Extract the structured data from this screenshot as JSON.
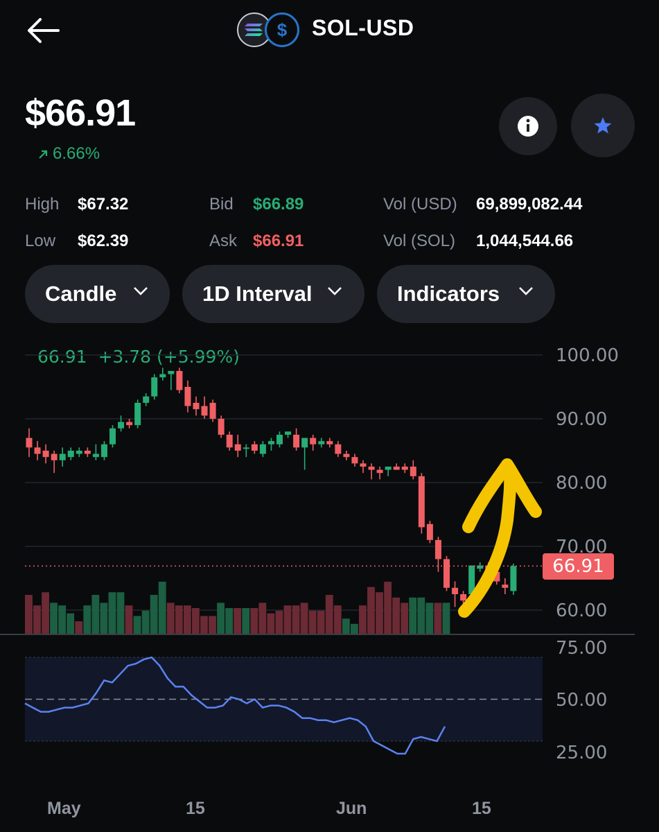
{
  "header": {
    "title": "SOL-USD",
    "base_icon": "solana-logo",
    "quote_icon": "usd-coin-logo"
  },
  "price": {
    "current": "$66.91",
    "change": "6.66%"
  },
  "stats": {
    "high_label": "High",
    "high_value": "$67.32",
    "low_label": "Low",
    "low_value": "$62.39",
    "bid_label": "Bid",
    "bid_value": "$66.89",
    "ask_label": "Ask",
    "ask_value": "$66.91",
    "vol_usd_label": "Vol (USD)",
    "vol_usd_value": "69,899,082.44",
    "vol_sol_label": "Vol (SOL)",
    "vol_sol_value": "1,044,544.66"
  },
  "controls": {
    "chart_type": "Candle",
    "interval": "1D Interval",
    "indicators": "Indicators"
  },
  "colors": {
    "up": "#27ad75",
    "down": "#f05f63",
    "accent": "#4c7cf5",
    "rsi_line": "#5b83f0",
    "annotation": "#f5c400"
  },
  "chart_data": {
    "type": "candlestick",
    "summary": "66.91  +3.78 (+5.99%)",
    "last_price_tag": "66.91",
    "y_ticks": [
      "100.00",
      "90.00",
      "80.00",
      "70.00",
      "60.00"
    ],
    "ylim": [
      56,
      100
    ],
    "x_ticks": [
      "May",
      "15",
      "Jun",
      "15"
    ],
    "candles": [
      {
        "o": 87.0,
        "h": 88.5,
        "l": 84.0,
        "c": 85.5
      },
      {
        "o": 85.5,
        "h": 86.5,
        "l": 83.5,
        "c": 84.5
      },
      {
        "o": 85.0,
        "h": 86.0,
        "l": 83.0,
        "c": 84.0
      },
      {
        "o": 84.5,
        "h": 85.0,
        "l": 81.5,
        "c": 83.5
      },
      {
        "o": 83.5,
        "h": 85.5,
        "l": 82.5,
        "c": 84.5
      },
      {
        "o": 84.0,
        "h": 85.5,
        "l": 83.5,
        "c": 85.0
      },
      {
        "o": 84.5,
        "h": 85.5,
        "l": 84.0,
        "c": 85.0
      },
      {
        "o": 85.0,
        "h": 85.5,
        "l": 84.0,
        "c": 84.5
      },
      {
        "o": 84.0,
        "h": 86.0,
        "l": 83.5,
        "c": 84.5
      },
      {
        "o": 84.0,
        "h": 86.5,
        "l": 83.5,
        "c": 86.0
      },
      {
        "o": 86.0,
        "h": 89.0,
        "l": 85.5,
        "c": 88.5
      },
      {
        "o": 88.5,
        "h": 90.5,
        "l": 88.0,
        "c": 89.5
      },
      {
        "o": 89.5,
        "h": 90.0,
        "l": 88.5,
        "c": 89.0
      },
      {
        "o": 89.0,
        "h": 93.0,
        "l": 88.5,
        "c": 92.5
      },
      {
        "o": 92.5,
        "h": 94.0,
        "l": 92.0,
        "c": 93.5
      },
      {
        "o": 93.5,
        "h": 97.0,
        "l": 93.0,
        "c": 96.5
      },
      {
        "o": 96.5,
        "h": 98.0,
        "l": 96.0,
        "c": 97.0
      },
      {
        "o": 97.0,
        "h": 97.5,
        "l": 94.5,
        "c": 97.5
      },
      {
        "o": 97.5,
        "h": 98.0,
        "l": 94.0,
        "c": 94.5
      },
      {
        "o": 95.0,
        "h": 96.0,
        "l": 91.0,
        "c": 92.0
      },
      {
        "o": 92.5,
        "h": 93.5,
        "l": 90.5,
        "c": 91.5
      },
      {
        "o": 92.0,
        "h": 93.5,
        "l": 90.0,
        "c": 90.5
      },
      {
        "o": 92.5,
        "h": 93.0,
        "l": 89.5,
        "c": 90.0
      },
      {
        "o": 90.0,
        "h": 90.5,
        "l": 87.0,
        "c": 87.5
      },
      {
        "o": 87.5,
        "h": 88.0,
        "l": 85.0,
        "c": 85.5
      },
      {
        "o": 86.0,
        "h": 87.5,
        "l": 84.0,
        "c": 85.0
      },
      {
        "o": 85.5,
        "h": 86.0,
        "l": 84.0,
        "c": 85.5
      },
      {
        "o": 86.0,
        "h": 86.5,
        "l": 84.5,
        "c": 85.0
      },
      {
        "o": 84.5,
        "h": 86.5,
        "l": 84.0,
        "c": 86.0
      },
      {
        "o": 86.0,
        "h": 87.0,
        "l": 85.0,
        "c": 86.5
      },
      {
        "o": 86.0,
        "h": 88.0,
        "l": 85.5,
        "c": 87.5
      },
      {
        "o": 87.5,
        "h": 88.0,
        "l": 87.0,
        "c": 88.0
      },
      {
        "o": 87.5,
        "h": 88.5,
        "l": 85.0,
        "c": 85.5
      },
      {
        "o": 85.5,
        "h": 87.0,
        "l": 82.0,
        "c": 87.0
      },
      {
        "o": 87.0,
        "h": 87.5,
        "l": 85.0,
        "c": 86.0
      },
      {
        "o": 86.0,
        "h": 87.0,
        "l": 85.5,
        "c": 86.5
      },
      {
        "o": 86.5,
        "h": 87.0,
        "l": 85.5,
        "c": 86.0
      },
      {
        "o": 86.0,
        "h": 86.5,
        "l": 84.0,
        "c": 84.5
      },
      {
        "o": 84.5,
        "h": 85.0,
        "l": 83.5,
        "c": 84.0
      },
      {
        "o": 84.0,
        "h": 84.5,
        "l": 82.5,
        "c": 83.0
      },
      {
        "o": 83.0,
        "h": 83.5,
        "l": 81.5,
        "c": 82.5
      },
      {
        "o": 82.5,
        "h": 83.0,
        "l": 80.5,
        "c": 82.0
      },
      {
        "o": 82.0,
        "h": 82.5,
        "l": 80.5,
        "c": 81.5
      },
      {
        "o": 82.0,
        "h": 82.5,
        "l": 81.0,
        "c": 82.5
      },
      {
        "o": 82.5,
        "h": 83.0,
        "l": 82.0,
        "c": 82.0
      },
      {
        "o": 82.5,
        "h": 83.0,
        "l": 81.5,
        "c": 82.0
      },
      {
        "o": 82.5,
        "h": 83.5,
        "l": 80.5,
        "c": 81.0
      },
      {
        "o": 81.0,
        "h": 81.5,
        "l": 72.0,
        "c": 73.0
      },
      {
        "o": 73.5,
        "h": 74.0,
        "l": 70.5,
        "c": 71.0
      },
      {
        "o": 71.0,
        "h": 71.5,
        "l": 66.0,
        "c": 68.0
      },
      {
        "o": 68.0,
        "h": 68.5,
        "l": 63.0,
        "c": 63.5
      },
      {
        "o": 63.5,
        "h": 64.5,
        "l": 60.5,
        "c": 62.5
      },
      {
        "o": 62.5,
        "h": 63.0,
        "l": 60.0,
        "c": 61.5
      },
      {
        "o": 62.5,
        "h": 67.0,
        "l": 61.5,
        "c": 67.0
      },
      {
        "o": 66.5,
        "h": 67.5,
        "l": 66.0,
        "c": 67.0
      },
      {
        "o": 67.0,
        "h": 67.5,
        "l": 65.5,
        "c": 66.0
      },
      {
        "o": 66.0,
        "h": 66.5,
        "l": 64.0,
        "c": 64.5
      },
      {
        "o": 64.0,
        "h": 65.0,
        "l": 62.5,
        "c": 63.5
      },
      {
        "o": 63.0,
        "h": 67.3,
        "l": 62.4,
        "c": 66.91
      }
    ],
    "rsi": {
      "y_ticks": [
        "75.00",
        "50.00",
        "25.00"
      ],
      "ylim": [
        20,
        80
      ],
      "upper": 70,
      "mid": 50,
      "lower": 30,
      "values": [
        48,
        46,
        44,
        44,
        45,
        46,
        46,
        47,
        48,
        53,
        59,
        58,
        62,
        66,
        67,
        69,
        70,
        66,
        60,
        56,
        56,
        52,
        49,
        46,
        46,
        47,
        51,
        50,
        48,
        50,
        46,
        47,
        47,
        46,
        44,
        41,
        41,
        40,
        40,
        39,
        40,
        41,
        40,
        37,
        30,
        28,
        26,
        24,
        24,
        31,
        32,
        31,
        30,
        37
      ]
    },
    "volume": [
      {
        "v": 0.75,
        "up": false
      },
      {
        "v": 0.55,
        "up": false
      },
      {
        "v": 0.8,
        "up": false
      },
      {
        "v": 0.6,
        "up": true
      },
      {
        "v": 0.55,
        "up": true
      },
      {
        "v": 0.4,
        "up": true
      },
      {
        "v": 0.25,
        "up": false
      },
      {
        "v": 0.55,
        "up": true
      },
      {
        "v": 0.75,
        "up": true
      },
      {
        "v": 0.6,
        "up": true
      },
      {
        "v": 0.8,
        "up": true
      },
      {
        "v": 0.8,
        "up": true
      },
      {
        "v": 0.55,
        "up": false
      },
      {
        "v": 0.35,
        "up": true
      },
      {
        "v": 0.45,
        "up": true
      },
      {
        "v": 0.75,
        "up": true
      },
      {
        "v": 1.0,
        "up": true
      },
      {
        "v": 0.6,
        "up": false
      },
      {
        "v": 0.55,
        "up": false
      },
      {
        "v": 0.55,
        "up": false
      },
      {
        "v": 0.5,
        "up": false
      },
      {
        "v": 0.35,
        "up": false
      },
      {
        "v": 0.35,
        "up": false
      },
      {
        "v": 0.6,
        "up": true
      },
      {
        "v": 0.5,
        "up": true
      },
      {
        "v": 0.5,
        "up": false
      },
      {
        "v": 0.5,
        "up": true
      },
      {
        "v": 0.5,
        "up": false
      },
      {
        "v": 0.6,
        "up": false
      },
      {
        "v": 0.4,
        "up": false
      },
      {
        "v": 0.45,
        "up": false
      },
      {
        "v": 0.55,
        "up": false
      },
      {
        "v": 0.55,
        "up": false
      },
      {
        "v": 0.6,
        "up": false
      },
      {
        "v": 0.45,
        "up": false
      },
      {
        "v": 0.45,
        "up": false
      },
      {
        "v": 0.75,
        "up": false
      },
      {
        "v": 0.55,
        "up": false
      },
      {
        "v": 0.3,
        "up": true
      },
      {
        "v": 0.2,
        "up": true
      },
      {
        "v": 0.55,
        "up": false
      },
      {
        "v": 0.9,
        "up": false
      },
      {
        "v": 0.8,
        "up": false
      },
      {
        "v": 1.0,
        "up": false
      },
      {
        "v": 0.7,
        "up": false
      },
      {
        "v": 0.6,
        "up": false
      },
      {
        "v": 0.7,
        "up": true
      },
      {
        "v": 0.7,
        "up": true
      },
      {
        "v": 0.6,
        "up": true
      },
      {
        "v": 0.6,
        "up": false
      },
      {
        "v": 0.6,
        "up": true
      }
    ]
  }
}
